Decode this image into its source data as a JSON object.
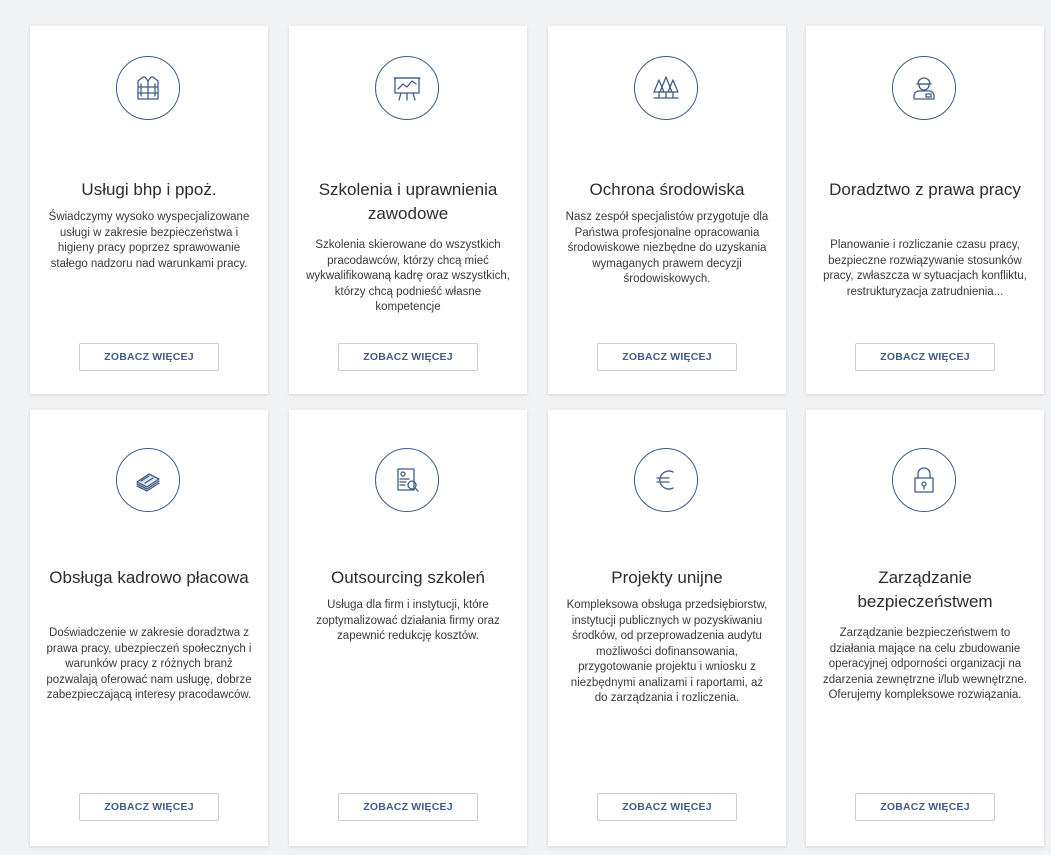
{
  "accent_color": "#3f5d86",
  "cards": [
    {
      "icon": "vest-icon",
      "title": "Usługi bhp i ppoż.",
      "description": "Świadczymy wysoko wyspecjalizowane usługi w zakresie bezpieczeństwa i higieny pracy poprzez sprawowanie stałego nadzoru nad warunkami pracy.",
      "button_label": "ZOBACZ WIĘCEJ"
    },
    {
      "icon": "presentation-board-icon",
      "title": "Szkolenia i uprawnienia zawodowe",
      "description": "Szkolenia skierowane do wszystkich pracodawców, którzy chcą mieć wykwalifikowaną kadrę oraz wszystkich, którzy chcą podnieść własne kompetencje",
      "button_label": "ZOBACZ WIĘCEJ"
    },
    {
      "icon": "trees-icon",
      "title": "Ochrona środowiska",
      "description": "Nasz zespół specjalistów przygotuje dla Państwa profesjonalne opracowania środowiskowe niezbędne do uzyskania wymaganych prawem decyzji środowiskowych.",
      "button_label": "ZOBACZ WIĘCEJ"
    },
    {
      "icon": "worker-icon",
      "title": "Doradztwo z prawa pracy",
      "description": "Planowanie i rozliczanie czasu pracy, bezpieczne rozwiązywanie stosunków pracy, zwłaszcza w sytuacjach konfliktu, restrukturyzacja zatrudnienia...",
      "button_label": "ZOBACZ WIĘCEJ"
    },
    {
      "icon": "money-stack-icon",
      "title": "Obsługa kadrowo płacowa",
      "description": "Doświadczenie w zakresie doradztwa z prawa pracy, ubezpieczeń społecznych i warunków pracy z różnych branż pozwalają oferować nam usługę, dobrze zabezpieczającą interesy pracodawców.",
      "button_label": "ZOBACZ WIĘCEJ"
    },
    {
      "icon": "document-search-icon",
      "title": "Outsourcing szkoleń",
      "description": "Usługa dla firm i instytucji, które zoptymalizować działania firmy oraz zapewnić redukcję kosztów.",
      "button_label": "ZOBACZ WIĘCEJ"
    },
    {
      "icon": "euro-icon",
      "title": "Projekty unijne",
      "description": "Kompleksowa obsługa przedsiębiorstw, instytucji publicznych w pozyskiwaniu środków, od przeprowadzenia audytu możliwości dofinansowania, przygotowanie projektu i wniosku z niezbędnymi analizami i raportami, aż do zarządzania i rozliczenia.",
      "button_label": "ZOBACZ WIĘCEJ"
    },
    {
      "icon": "padlock-icon",
      "title": "Zarządzanie bezpieczeństwem",
      "description": "Zarządzanie bezpieczeństwem to działania mające na celu zbudowanie operacyjnej odporności organizacji na zdarzenia zewnętrzne i/lub wewnętrzne. Oferujemy kompleksowe rozwiązania.",
      "button_label": "ZOBACZ WIĘCEJ"
    }
  ]
}
